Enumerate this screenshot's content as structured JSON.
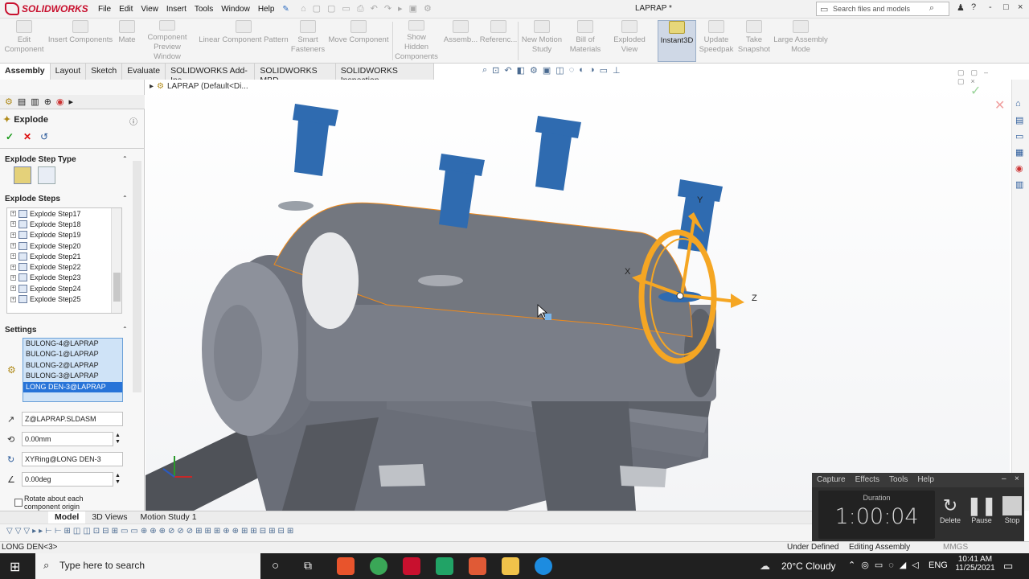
{
  "app": {
    "logo": "SOLIDWORKS",
    "doc_title": "LAPRAP *",
    "menu": [
      "File",
      "Edit",
      "View",
      "Insert",
      "Tools",
      "Window",
      "Help"
    ],
    "search_placeholder": "Search files and models",
    "window_controls": [
      "?",
      "-",
      "□",
      "×"
    ]
  },
  "ribbon": {
    "buttons": [
      {
        "label": "Edit Component"
      },
      {
        "label": "Insert Components"
      },
      {
        "label": "Mate"
      },
      {
        "label": "Component Preview Window"
      },
      {
        "label": "Linear Component Pattern"
      },
      {
        "label": "Smart Fasteners"
      },
      {
        "label": "Move Component"
      },
      {
        "label": "Show Hidden Components"
      },
      {
        "label": "Assemb..."
      },
      {
        "label": "Referenc..."
      },
      {
        "label": "New Motion Study"
      },
      {
        "label": "Bill of Materials"
      },
      {
        "label": "Exploded View"
      },
      {
        "label": "Instant3D"
      },
      {
        "label": "Update Speedpak"
      },
      {
        "label": "Take Snapshot"
      },
      {
        "label": "Large Assembly Mode"
      }
    ]
  },
  "command_tabs": [
    "Assembly",
    "Layout",
    "Sketch",
    "Evaluate",
    "SOLIDWORKS Add-Ins",
    "SOLIDWORKS MBD",
    "SOLIDWORKS Inspection"
  ],
  "tree_header": "LAPRAP  (Default<Di...",
  "explode": {
    "title": "Explode",
    "step_type_header": "Explode Step Type",
    "steps_header": "Explode Steps",
    "steps": [
      "Explode Step17",
      "Explode Step18",
      "Explode Step19",
      "Explode Step20",
      "Explode Step21",
      "Explode Step22",
      "Explode Step23",
      "Explode Step24",
      "Explode Step25"
    ],
    "settings_header": "Settings",
    "selection": [
      "BULONG-4@LAPRAP",
      "BULONG-1@LAPRAP",
      "BULONG-2@LAPRAP",
      "BULONG-3@LAPRAP",
      "LONG DEN-3@LAPRAP"
    ],
    "direction": "Z@LAPRAP.SLDASM",
    "distance": "0.00mm",
    "rotation_axis": "XYRing@LONG DEN-3",
    "angle": "0.00deg",
    "rotate_option": "Rotate about each component origin"
  },
  "triad": {
    "x": "X",
    "y": "Y",
    "z": "Z"
  },
  "bottom_tabs": [
    "Model",
    "3D Views",
    "Motion Study 1"
  ],
  "status": {
    "left": "LONG DEN<3>",
    "under_defined": "Under Defined",
    "mode": "Editing Assembly",
    "units": "MMGS"
  },
  "capture": {
    "menu": [
      "Capture",
      "Effects",
      "Tools",
      "Help"
    ],
    "duration_label": "Duration",
    "duration": "1:00:04",
    "buttons": [
      "Delete",
      "Pause",
      "Stop"
    ]
  },
  "taskbar": {
    "search": "Type here to search",
    "weather": "20°C  Cloudy",
    "lang": "ENG",
    "time": "10:41 AM",
    "date": "11/25/2021"
  }
}
